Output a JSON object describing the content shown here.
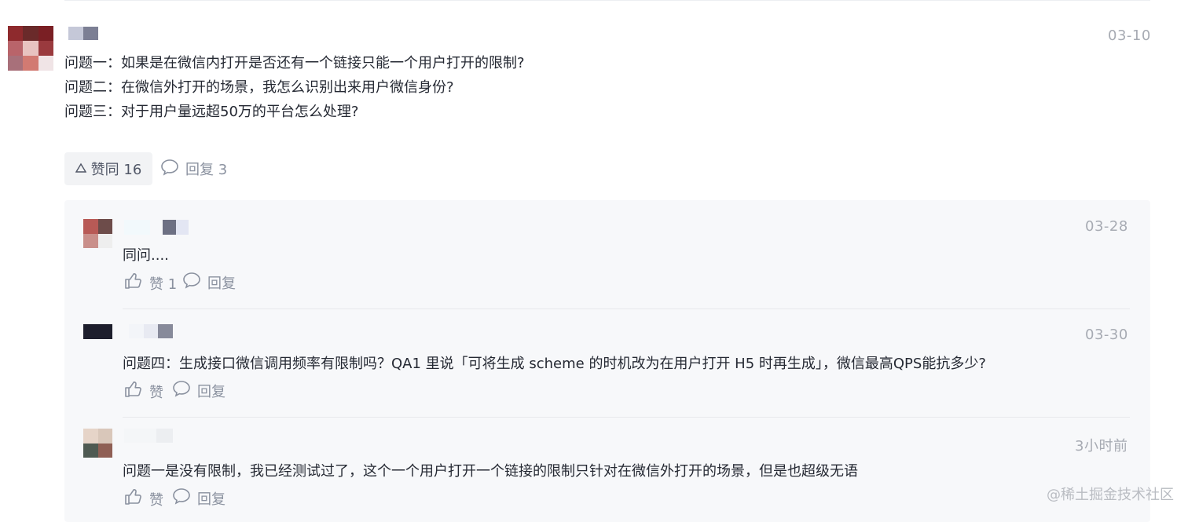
{
  "comment": {
    "date": "03-10",
    "lines": [
      "问题一：如果是在微信内打开是否还有一个链接只能一个用户打开的限制?",
      "问题二：在微信外打开的场景，我怎么识别出来用户微信身份?",
      "问题三：对于用户量远超50万的平台怎么处理?"
    ],
    "like_label": "赞同 16",
    "reply_label": "回复 3"
  },
  "replies": [
    {
      "date": "03-28",
      "text": "同问....",
      "like_label": "赞 1",
      "reply_label": "回复"
    },
    {
      "date": "03-30",
      "text": "问题四：生成接口微信调用频率有限制吗？QA1 里说「可将生成 scheme 的时机改为在用户打开 H5 时再生成」，微信最高QPS能抗多少?",
      "like_label": "赞",
      "reply_label": "回复"
    },
    {
      "date": "3小时前",
      "text": "问题一是没有限制，我已经测试过了，这个一个用户打开一个链接的限制只针对在微信外打开的场景，但是也超级无语",
      "like_label": "赞",
      "reply_label": "回复"
    }
  ],
  "watermark": "@稀土掘金技术社区",
  "icons": [
    "up-triangle-icon",
    "comment-icon",
    "thumbs-up-icon"
  ]
}
